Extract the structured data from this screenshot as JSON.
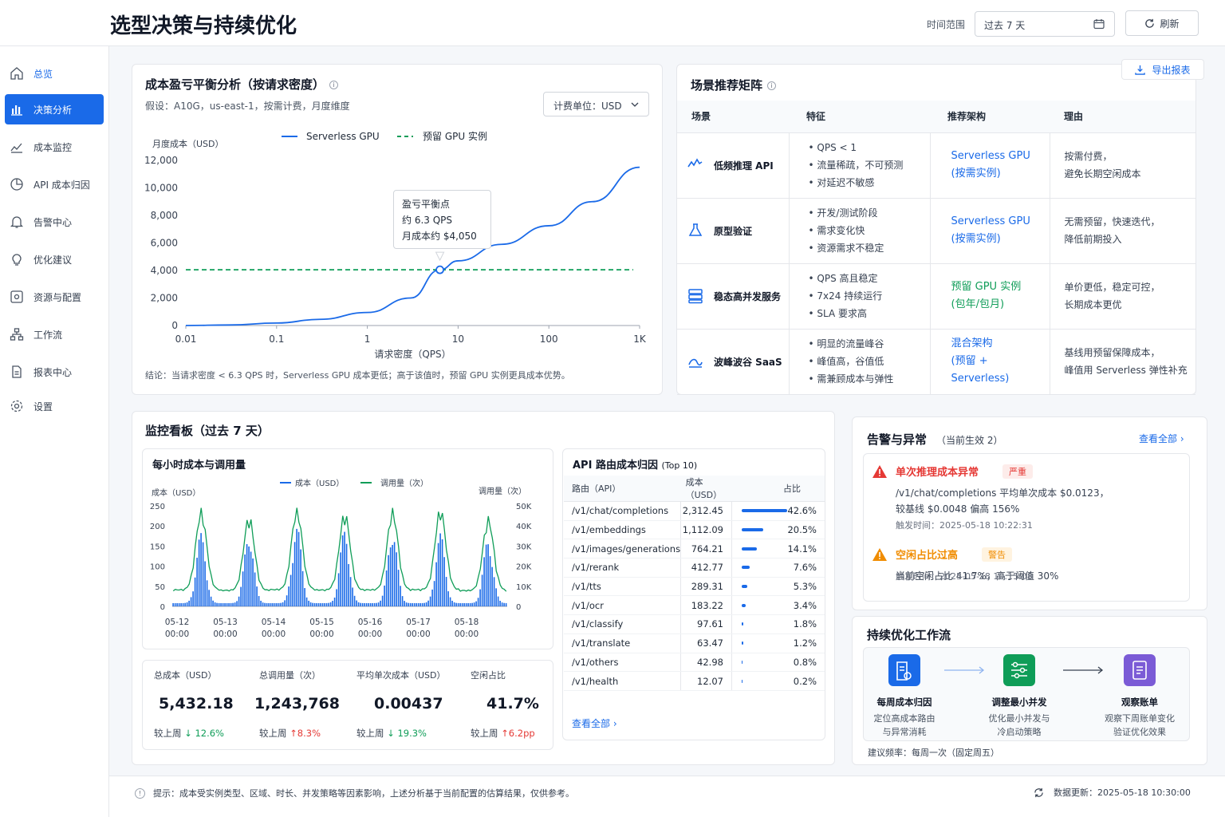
{
  "header": {
    "title": "选型决策与持续优化",
    "range_label": "时间范围",
    "range_value": "过去 7 天",
    "refresh": "刷新"
  },
  "sidebar": {
    "items": [
      {
        "label": "总览",
        "icon": "home-icon"
      },
      {
        "label": "决策分析",
        "icon": "bar-chart-icon",
        "active": true
      },
      {
        "label": "成本监控",
        "icon": "trend-icon"
      },
      {
        "label": "API 成本归因",
        "icon": "pie-icon"
      },
      {
        "label": "告警中心",
        "icon": "bell-icon"
      },
      {
        "label": "优化建议",
        "icon": "bulb-icon"
      },
      {
        "label": "资源与配置",
        "icon": "config-icon"
      },
      {
        "label": "工作流",
        "icon": "workflow-icon"
      },
      {
        "label": "报表中心",
        "icon": "report-icon"
      },
      {
        "label": "设置",
        "icon": "gear-icon"
      }
    ]
  },
  "breakeven": {
    "title": "成本盈亏平衡分析（按请求密度）",
    "assumption": "假设：A10G，us-east-1，按需计费，月度维度",
    "unit": "计费单位：USD",
    "tooltip": [
      "盈亏平衡点",
      "约 6.3 QPS",
      "月成本约 $4,050"
    ],
    "conclusion": "结论：当请求密度 < 6.3 QPS 时，Serverless GPU 成本更低；高于该值时，预留 GPU 实例更具成本优势。"
  },
  "scenario": {
    "title": "场景推荐矩阵",
    "export": "导出报表",
    "headers": [
      "场景",
      "特征",
      "推荐架构",
      "理由"
    ],
    "rows": [
      {
        "icon": "activity-icon",
        "name": "低频推理 API",
        "features": [
          "QPS < 1",
          "流量稀疏，不可预测",
          "对延迟不敏感"
        ],
        "arch": [
          "Serverless GPU",
          "(按需实例)"
        ],
        "arch_color": "#1a6ae8",
        "reason": [
          "按需付费，",
          "避免长期空闲成本"
        ]
      },
      {
        "icon": "flask-icon",
        "name": "原型验证",
        "features": [
          "开发/测试阶段",
          "需求变化快",
          "资源需求不稳定"
        ],
        "arch": [
          "Serverless GPU",
          "(按需实例)"
        ],
        "arch_color": "#1a6ae8",
        "reason": [
          "无需预留，快速迭代，",
          "降低前期投入"
        ]
      },
      {
        "icon": "server-icon",
        "name": "稳态高并发服务",
        "features": [
          "QPS 高且稳定",
          "7x24 持续运行",
          "SLA 要求高"
        ],
        "arch": [
          "预留 GPU 实例",
          "(包年/包月)"
        ],
        "arch_color": "#0f9d58",
        "reason": [
          "单价更低，稳定可控，",
          "长期成本更优"
        ]
      },
      {
        "icon": "wave-icon",
        "name": "波峰波谷 SaaS",
        "features": [
          "明显的流量峰谷",
          "峰值高，谷值低",
          "需兼顾成本与弹性"
        ],
        "arch": [
          "混合架构",
          "(预留 + Serverless)"
        ],
        "arch_color": "#1a6ae8",
        "reason": [
          "基线用预留保障成本，",
          "峰值用 Serverless 弹性补充"
        ]
      }
    ]
  },
  "monitor": {
    "title": "监控看板（过去 7 天）",
    "hourly_title": "每小时成本与调用量",
    "route_title": "API 路由成本归因",
    "route_top": "(Top 10)",
    "route_headers": [
      "路由（API）",
      "成本（USD）",
      "占比"
    ],
    "routes": [
      {
        "path": "/v1/chat/completions",
        "cost": "2,312.45",
        "pct": "42.6%",
        "share": 42.6
      },
      {
        "path": "/v1/embeddings",
        "cost": "1,112.09",
        "pct": "20.5%",
        "share": 20.5
      },
      {
        "path": "/v1/images/generations",
        "cost": "764.21",
        "pct": "14.1%",
        "share": 14.1
      },
      {
        "path": "/v1/rerank",
        "cost": "412.77",
        "pct": "7.6%",
        "share": 7.6
      },
      {
        "path": "/v1/tts",
        "cost": "289.31",
        "pct": "5.3%",
        "share": 5.3
      },
      {
        "path": "/v1/ocr",
        "cost": "183.22",
        "pct": "3.4%",
        "share": 3.4
      },
      {
        "path": "/v1/classify",
        "cost": "97.61",
        "pct": "1.8%",
        "share": 1.8
      },
      {
        "path": "/v1/translate",
        "cost": "63.47",
        "pct": "1.2%",
        "share": 1.2
      },
      {
        "path": "/v1/others",
        "cost": "42.98",
        "pct": "0.8%",
        "share": 0.8
      },
      {
        "path": "/v1/health",
        "cost": "12.07",
        "pct": "0.2%",
        "share": 0.2
      }
    ],
    "view_all": "查看全部 ›",
    "stats": [
      {
        "label": "总成本（USD）",
        "value": "5,432.18",
        "prefix": "较上周",
        "delta": "↓ 12.6%",
        "color": "#0f9d58"
      },
      {
        "label": "总调用量（次）",
        "value": "1,243,768",
        "prefix": "较上周",
        "delta": "↑8.3%",
        "color": "#e53935"
      },
      {
        "label": "平均单次成本（USD）",
        "value": "0.00437",
        "prefix": "较上周",
        "delta": "↓ 19.3%",
        "color": "#0f9d58"
      },
      {
        "label": "空闲占比",
        "value": "41.7%",
        "prefix": "较上周",
        "delta": "↑6.2pp",
        "color": "#e53935"
      }
    ]
  },
  "alerts": {
    "title": "告警与异常",
    "subtitle": "（当前生效 2）",
    "view_all": "查看全部 ›",
    "items": [
      {
        "title": "单次推理成本异常",
        "level": "严重",
        "level_color": "#e53935",
        "level_bg": "#fdecea",
        "desc1": "/v1/chat/completions 平均单次成本 $0.0123，",
        "desc2": "较基线 $0.0048 偏高 156%",
        "time": "触发时间：2025-05-18 10:22:31"
      },
      {
        "title": "空闲占比过高",
        "level": "警告",
        "level_color": "#f08c00",
        "level_bg": "#fff3e0",
        "desc1": "当前空闲占比 41.7%，高于阈值 30%",
        "desc2": "",
        "time": "触发时间：2025-05-18 10:15:08"
      }
    ]
  },
  "workflow": {
    "title": "持续优化工作流",
    "steps": [
      {
        "title": "每周成本归因",
        "desc": [
          "定位高成本路由",
          "与异常消耗"
        ],
        "color": "#1a6ae8"
      },
      {
        "title": "调整最小并发",
        "desc": [
          "优化最小并发与",
          "冷启动策略"
        ],
        "color": "#0f9d58"
      },
      {
        "title": "观察账单",
        "desc": [
          "观察下周账单变化",
          "验证优化效果"
        ],
        "color": "#7b5bd6"
      }
    ],
    "freq": "建议频率：每周一次（固定周五）"
  },
  "footer": {
    "tip": "提示：成本受实例类型、区域、时长、并发策略等因素影响，上述分析基于当前配置的估算结果，仅供参考。",
    "updated": "数据更新：2025-05-18 10:30:00"
  },
  "chart_data": [
    {
      "type": "line",
      "ylabel": "月度成本（USD）",
      "xlabel": "请求密度（QPS）",
      "x_scale": "log",
      "x_ticks": [
        "0.01",
        "0.1",
        "1",
        "10",
        "100",
        "1K"
      ],
      "x_tick_values": [
        0.01,
        0.1,
        1,
        10,
        100,
        1000
      ],
      "y_ticks": [
        "0",
        "2,000",
        "4,000",
        "6,000",
        "8,000",
        "10,000",
        "12,000"
      ],
      "ylim": [
        0,
        12000
      ],
      "xlim": [
        0.01,
        1000
      ],
      "series": [
        {
          "name": "Serverless GPU",
          "color": "#1a6ae8",
          "style": "solid",
          "x": [
            0.01,
            0.03,
            0.1,
            0.3,
            1,
            3,
            6.3,
            10,
            30,
            100,
            300,
            1000
          ],
          "y": [
            0,
            40,
            180,
            450,
            950,
            2000,
            4050,
            4700,
            5900,
            7250,
            9000,
            11500
          ]
        },
        {
          "name": "预留 GPU 实例",
          "color": "#0f9d58",
          "style": "dashed",
          "x": [
            0.01,
            1000
          ],
          "y": [
            4050,
            4050
          ]
        }
      ],
      "annotation": {
        "x": 6.3,
        "y": 4050
      },
      "legend": "top"
    },
    {
      "type": "bar",
      "ylabel_left": "成本（USD）",
      "ylabel_right": "调用量（次）",
      "y_left_ticks": [
        "0",
        "50",
        "100",
        "150",
        "200",
        "250"
      ],
      "y_right_ticks": [
        "0",
        "10K",
        "20K",
        "30K",
        "40K",
        "50K"
      ],
      "ylim_left": [
        0,
        250
      ],
      "ylim_right": [
        0,
        50000
      ],
      "x_ticks": [
        "05-12\n00:00",
        "05-13\n00:00",
        "05-14\n00:00",
        "05-15\n00:00",
        "05-16\n00:00",
        "05-17\n00:00",
        "05-18\n00:00"
      ],
      "days": 7,
      "hours_per_day": 24,
      "series": [
        {
          "name": "成本（USD）",
          "color": "#1a6ae8",
          "kind": "bar"
        },
        {
          "name": "调用量（次）",
          "color": "#0f9d58",
          "kind": "line"
        }
      ],
      "daily_peak_cost": [
        175,
        180,
        195,
        185,
        190,
        175,
        165
      ],
      "daily_peak_calls": [
        45000,
        42000,
        46000,
        44000,
        45000,
        46000,
        41000
      ],
      "legend": "top"
    }
  ]
}
